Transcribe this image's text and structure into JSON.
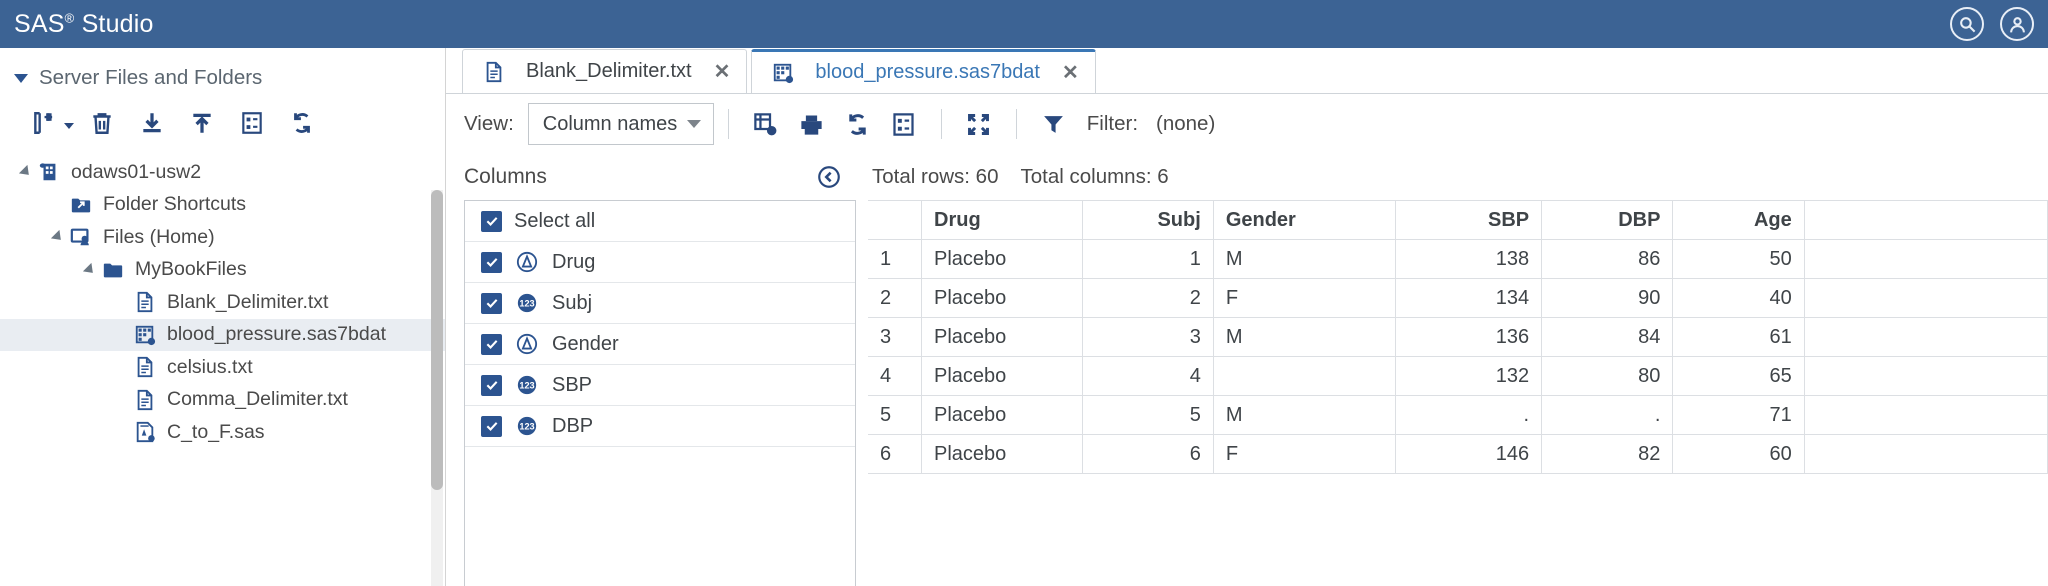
{
  "app": {
    "title_main": "SAS",
    "title_sup": "®",
    "title_rest": "Studio",
    "icons": {
      "search": "search-icon",
      "user": "user-account-icon"
    }
  },
  "sidebar": {
    "header_title": "Server Files and Folders",
    "toolbar": [
      {
        "name": "new-icon",
        "label": "New"
      },
      {
        "name": "delete-icon",
        "label": "Delete"
      },
      {
        "name": "download-icon",
        "label": "Download"
      },
      {
        "name": "upload-icon",
        "label": "Upload"
      },
      {
        "name": "properties-icon",
        "label": "Properties"
      },
      {
        "name": "refresh-icon",
        "label": "Refresh"
      }
    ],
    "tree": [
      {
        "label": "odaws01-usw2",
        "icon": "server-icon",
        "indent": 0,
        "twisty": true,
        "selected": false
      },
      {
        "label": "Folder Shortcuts",
        "icon": "shortcut-icon",
        "indent": 1,
        "twisty": false,
        "selected": false
      },
      {
        "label": "Files (Home)",
        "icon": "home-icon",
        "indent": 1,
        "twisty": true,
        "selected": false
      },
      {
        "label": "MyBookFiles",
        "icon": "folder-icon",
        "indent": 2,
        "twisty": true,
        "selected": false
      },
      {
        "label": "Blank_Delimiter.txt",
        "icon": "text-file-icon",
        "indent": 3,
        "twisty": false,
        "selected": false
      },
      {
        "label": "blood_pressure.sas7bdat",
        "icon": "dataset-icon",
        "indent": 3,
        "twisty": false,
        "selected": true
      },
      {
        "label": "celsius.txt",
        "icon": "text-file-icon",
        "indent": 3,
        "twisty": false,
        "selected": false
      },
      {
        "label": "Comma_Delimiter.txt",
        "icon": "text-file-icon",
        "indent": 3,
        "twisty": false,
        "selected": false
      },
      {
        "label": "C_to_F.sas",
        "icon": "sas-file-icon",
        "indent": 3,
        "twisty": false,
        "selected": false
      }
    ]
  },
  "tabs": [
    {
      "label": "Blank_Delimiter.txt",
      "icon": "text-file-icon",
      "active": false,
      "close": "✕"
    },
    {
      "label": "blood_pressure.sas7bdat",
      "icon": "dataset-icon",
      "active": true,
      "close": "✕"
    }
  ],
  "viewbar": {
    "view_label": "View:",
    "select_value": "Column names",
    "buttons": [
      {
        "name": "table-export-icon",
        "label": "Export"
      },
      {
        "name": "print-icon",
        "label": "Print"
      },
      {
        "name": "refresh-icon",
        "label": "Refresh"
      },
      {
        "name": "properties-icon",
        "label": "Properties"
      },
      {
        "name": "maximize-icon",
        "label": "Maximize view"
      }
    ],
    "filter_label": "Filter:",
    "filter_value": "(none)"
  },
  "columns_panel": {
    "title": "Columns",
    "collapse_icon": "collapse-left-icon",
    "rows": [
      {
        "label": "Select all",
        "type": null,
        "checked": true
      },
      {
        "label": "Drug",
        "type": "char",
        "checked": true
      },
      {
        "label": "Subj",
        "type": "numeric",
        "checked": true
      },
      {
        "label": "Gender",
        "type": "char",
        "checked": true
      },
      {
        "label": "SBP",
        "type": "numeric",
        "checked": true
      },
      {
        "label": "DBP",
        "type": "numeric",
        "checked": true
      }
    ]
  },
  "grid": {
    "total_rows_label": "Total rows: 60",
    "total_columns_label": "Total columns: 6",
    "headers": [
      "",
      "Drug",
      "Subj",
      "Gender",
      "SBP",
      "DBP",
      "Age",
      ""
    ],
    "rows": [
      {
        "n": "1",
        "drug": "Placebo",
        "subj": "1",
        "gender": "M",
        "sbp": "138",
        "dbp": "86",
        "age": "50"
      },
      {
        "n": "2",
        "drug": "Placebo",
        "subj": "2",
        "gender": "F",
        "sbp": "134",
        "dbp": "90",
        "age": "40"
      },
      {
        "n": "3",
        "drug": "Placebo",
        "subj": "3",
        "gender": "M",
        "sbp": "136",
        "dbp": "84",
        "age": "61"
      },
      {
        "n": "4",
        "drug": "Placebo",
        "subj": "4",
        "gender": "",
        "sbp": "132",
        "dbp": "80",
        "age": "65"
      },
      {
        "n": "5",
        "drug": "Placebo",
        "subj": "5",
        "gender": "M",
        "sbp": ".",
        "dbp": ".",
        "age": "71"
      },
      {
        "n": "6",
        "drug": "Placebo",
        "subj": "6",
        "gender": "F",
        "sbp": "146",
        "dbp": "82",
        "age": "60"
      }
    ]
  }
}
